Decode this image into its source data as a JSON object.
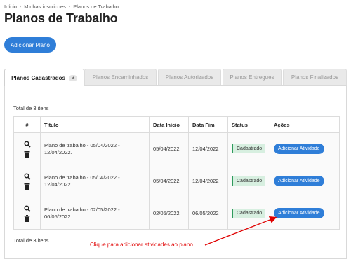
{
  "breadcrumb": [
    "Início",
    "Minhas inscricoes",
    "Planos de Trabalho"
  ],
  "title": "Planos de Trabalho",
  "add_plan_label": "Adicionar Plano",
  "tabs": [
    {
      "label": "Planos Cadastrados",
      "count": "3",
      "active": true
    },
    {
      "label": "Planos Encaminhados"
    },
    {
      "label": "Planos Autorizados"
    },
    {
      "label": "Planos Entregues"
    },
    {
      "label": "Planos Finalizados"
    }
  ],
  "total_text": "Total de 3 itens",
  "table": {
    "headers": [
      "#",
      "Título",
      "Data Início",
      "Data Fim",
      "Status",
      "Ações"
    ],
    "rows": [
      {
        "title": "Plano de trabalho - 05/04/2022 - 12/04/2022.",
        "start": "05/04/2022",
        "end": "12/04/2022",
        "status": "Cadastrado",
        "action": "Adicionar Atividade"
      },
      {
        "title": "Plano de trabalho - 05/04/2022 - 12/04/2022.",
        "start": "05/04/2022",
        "end": "12/04/2022",
        "status": "Cadastrado",
        "action": "Adicionar Atividade"
      },
      {
        "title": "Plano de trabalho - 02/05/2022 - 06/05/2022.",
        "start": "02/05/2022",
        "end": "06/05/2022",
        "status": "Cadastrado",
        "action": "Adicionar Atividade"
      }
    ]
  },
  "annotation": "Clique para adicionar atividades ao plano",
  "colors": {
    "primary": "#2f7ed8",
    "status_bg": "#d7efe0",
    "status_border": "#2e9a5c",
    "annotation": "#e00000"
  },
  "icons": {
    "view": "magnifier-icon",
    "delete": "trash-icon"
  }
}
